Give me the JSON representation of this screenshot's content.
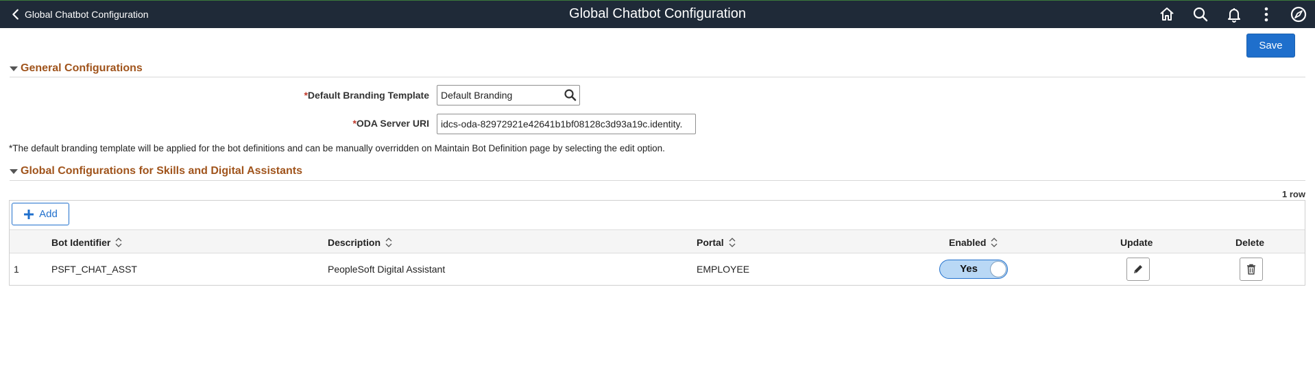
{
  "header": {
    "back_label": "Global Chatbot Configuration",
    "title": "Global Chatbot Configuration",
    "icons": [
      "home-icon",
      "search-icon",
      "notification-bell-icon",
      "actions-menu-icon",
      "navbar-compass-icon"
    ],
    "background_color": "#1f2a38"
  },
  "toolbar": {
    "save_label": "Save"
  },
  "general": {
    "section_title": "General Configurations",
    "branding_label_req": "*",
    "branding_label": "Default Branding Template",
    "branding_value": "Default Branding",
    "oda_label_req": "*",
    "oda_label": "ODA Server URI",
    "oda_value": "idcs-oda-82972921e42641b1bf08128c3d93a19c.identity.",
    "note": "*The default branding template will be applied for the bot definitions and can be manually overridden on Maintain Bot Definition page by selecting the edit option."
  },
  "skills": {
    "section_title": "Global Configurations for Skills and Digital Assistants",
    "row_count": "1 row",
    "add_label": "Add",
    "columns": {
      "bot_identifier": "Bot Identifier",
      "description": "Description",
      "portal": "Portal",
      "enabled": "Enabled",
      "update": "Update",
      "delete": "Delete"
    },
    "rows": [
      {
        "num": "1",
        "bot_identifier": "PSFT_CHAT_ASST",
        "description": "PeopleSoft Digital Assistant",
        "portal": "EMPLOYEE",
        "enabled": "Yes"
      }
    ]
  },
  "colors": {
    "primary": "#1f6fcc",
    "section_title": "#a0541c",
    "toggle_on": "#b9d8f5"
  }
}
